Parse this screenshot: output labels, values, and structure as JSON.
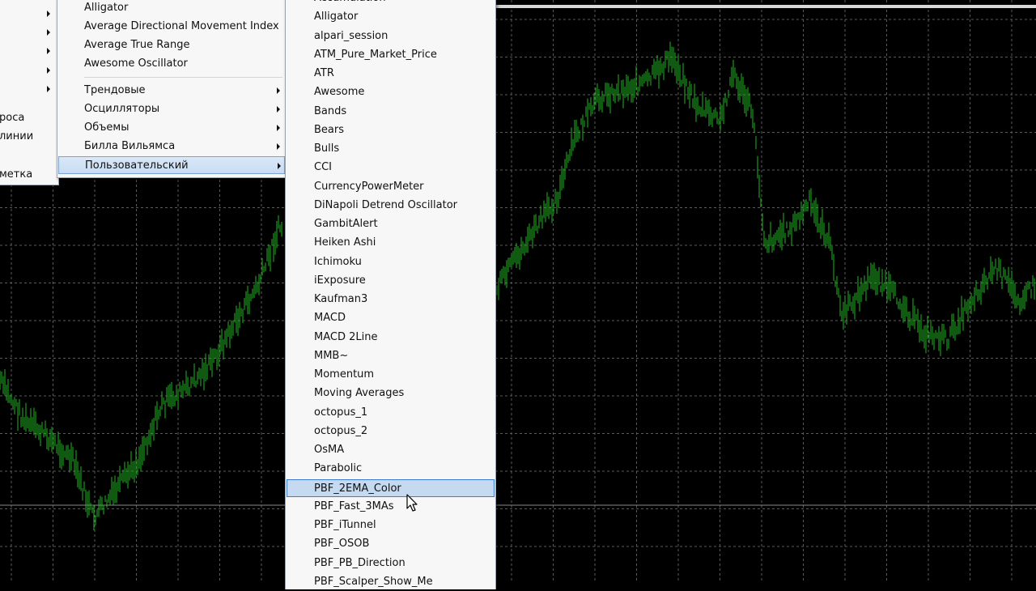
{
  "colors": {
    "chart_background": "#000000",
    "chart_grid": "#5a5a5a",
    "chart_candles": "#22b422",
    "menu_background": "#f7f7f7",
    "menu_highlight": "#c5d9f1"
  },
  "left_menu": {
    "items": [
      {
        "label": "роса"
      },
      {
        "label": "линии"
      },
      {
        "label": "метка"
      }
    ]
  },
  "middle_menu": {
    "items": [
      {
        "label": "Alligator"
      },
      {
        "label": "Average Directional Movement Index"
      },
      {
        "label": "Average True Range"
      },
      {
        "label": "Awesome Oscillator"
      },
      {
        "label": "Трендовые"
      },
      {
        "label": "Осцилляторы"
      },
      {
        "label": "Объемы"
      },
      {
        "label": "Билла Вильямса"
      },
      {
        "label": "Пользовательский"
      }
    ]
  },
  "custom_menu": {
    "items": [
      {
        "label": "Accumulation"
      },
      {
        "label": "Alligator"
      },
      {
        "label": "alpari_session"
      },
      {
        "label": "ATM_Pure_Market_Price"
      },
      {
        "label": "ATR"
      },
      {
        "label": "Awesome"
      },
      {
        "label": "Bands"
      },
      {
        "label": "Bears"
      },
      {
        "label": "Bulls"
      },
      {
        "label": "CCI"
      },
      {
        "label": "CurrencyPowerMeter"
      },
      {
        "label": "DiNapoli Detrend Oscillator"
      },
      {
        "label": "GambitAlert"
      },
      {
        "label": "Heiken Ashi"
      },
      {
        "label": "Ichimoku"
      },
      {
        "label": "iExposure"
      },
      {
        "label": "Kaufman3"
      },
      {
        "label": "MACD"
      },
      {
        "label": "MACD 2Line"
      },
      {
        "label": "MMB~"
      },
      {
        "label": "Momentum"
      },
      {
        "label": "Moving Averages"
      },
      {
        "label": "octopus_1"
      },
      {
        "label": "octopus_2"
      },
      {
        "label": "OsMA"
      },
      {
        "label": "Parabolic"
      },
      {
        "label": "PBF_2EMA_Color"
      },
      {
        "label": "PBF_Fast_3MAs"
      },
      {
        "label": "PBF_iTunnel"
      },
      {
        "label": "PBF_OSOB"
      },
      {
        "label": "PBF_PB_Direction"
      },
      {
        "label": "PBF_Scalper_Show_Me"
      }
    ]
  }
}
